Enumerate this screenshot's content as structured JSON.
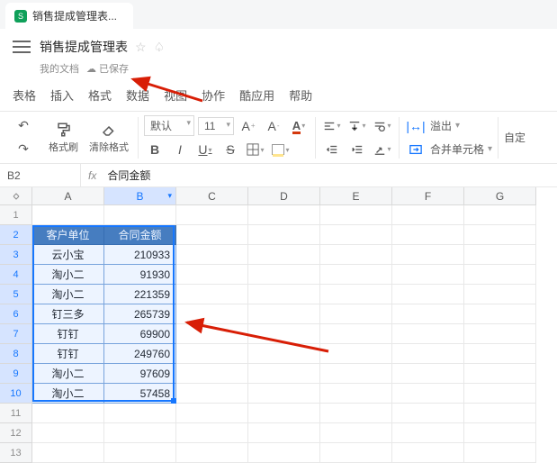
{
  "tab": {
    "title": "销售提成管理表..."
  },
  "doc": {
    "title": "销售提成管理表",
    "location": "我的文档",
    "saved_label": "已保存"
  },
  "menu": [
    "表格",
    "插入",
    "格式",
    "数据",
    "视图",
    "协作",
    "酷应用",
    "帮助"
  ],
  "toolbar": {
    "format_painter": "格式刷",
    "clear_format": "清除格式",
    "font_name": "默认",
    "font_size": "11",
    "overflow": "溢出",
    "merge": "合并单元格",
    "custom": "自定"
  },
  "refbar": {
    "cell": "B2",
    "formula": "合同金额"
  },
  "columns": [
    "A",
    "B",
    "C",
    "D",
    "E",
    "F",
    "G"
  ],
  "sel_col_index": 1,
  "row_count": 13,
  "chart_data": {
    "type": "table",
    "title": "",
    "headers": [
      "客户单位",
      "合同金额"
    ],
    "rows": [
      [
        "云小宝",
        210933
      ],
      [
        "淘小二",
        91930
      ],
      [
        "淘小二",
        221359
      ],
      [
        "钉三多",
        265739
      ],
      [
        "钉钉",
        69900
      ],
      [
        "钉钉",
        249760
      ],
      [
        "淘小二",
        97609
      ],
      [
        "淘小二",
        57458
      ]
    ]
  }
}
